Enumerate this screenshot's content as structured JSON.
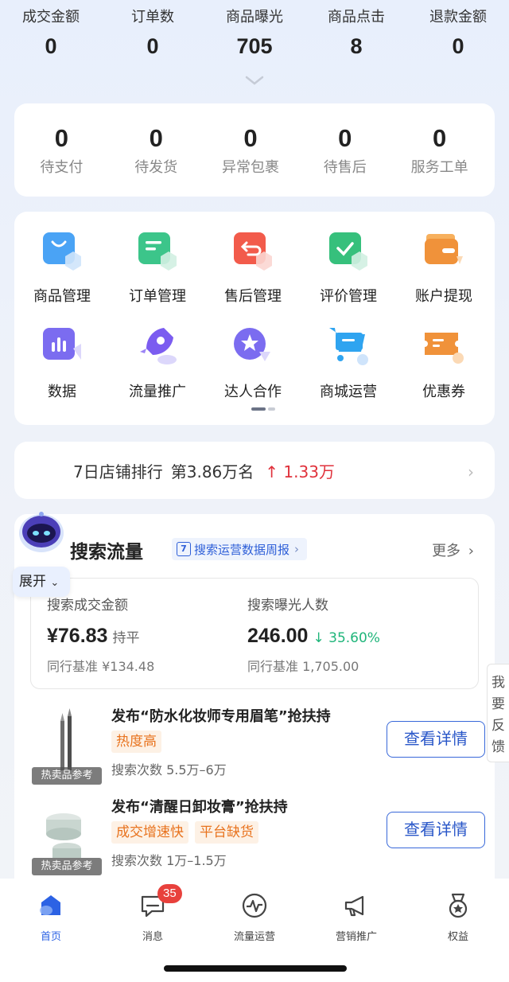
{
  "top_stats": [
    {
      "label": "成交金额",
      "value": "0"
    },
    {
      "label": "订单数",
      "value": "0"
    },
    {
      "label": "商品曝光",
      "value": "705"
    },
    {
      "label": "商品点击",
      "value": "8"
    },
    {
      "label": "退款金额",
      "value": "0"
    }
  ],
  "order_status": [
    {
      "label": "待支付",
      "value": "0"
    },
    {
      "label": "待发货",
      "value": "0"
    },
    {
      "label": "异常包裹",
      "value": "0"
    },
    {
      "label": "待售后",
      "value": "0"
    },
    {
      "label": "服务工单",
      "value": "0"
    }
  ],
  "tools": [
    {
      "label": "商品管理",
      "icon": "shopping-bag-icon"
    },
    {
      "label": "订单管理",
      "icon": "order-list-icon"
    },
    {
      "label": "售后管理",
      "icon": "return-icon"
    },
    {
      "label": "评价管理",
      "icon": "review-check-icon"
    },
    {
      "label": "账户提现",
      "icon": "wallet-icon"
    },
    {
      "label": "数据",
      "icon": "bar-chart-icon"
    },
    {
      "label": "流量推广",
      "icon": "rocket-icon"
    },
    {
      "label": "达人合作",
      "icon": "star-badge-icon"
    },
    {
      "label": "商城运营",
      "icon": "cart-icon"
    },
    {
      "label": "优惠券",
      "icon": "coupon-icon"
    }
  ],
  "rank": {
    "text": "7日店铺排行",
    "rank": "第3.86万名",
    "change": "1.33万"
  },
  "search": {
    "title": "搜索流量",
    "tag_day": "7",
    "tag": "搜索运营数据周报",
    "more": "更多",
    "metrics": [
      {
        "label": "搜索成交金额",
        "value": "¥76.83",
        "trend": "持平",
        "benchmark": "同行基准 ¥134.48"
      },
      {
        "label": "搜索曝光人数",
        "value": "246.00",
        "trend": "35.60%",
        "benchmark": "同行基准 1,705.00"
      }
    ],
    "products": [
      {
        "title": "发布“防水化妆师专用眉笔”抢扶持",
        "tags": [
          "热度高"
        ],
        "count": "搜索次数 5.5万–6万",
        "ref": "热卖品参考",
        "button": "查看详情"
      },
      {
        "title": "发布“清醒日卸妆膏”抢扶持",
        "tags": [
          "成交增速快",
          "平台缺货"
        ],
        "count": "搜索次数 1万–1.5万",
        "ref": "热卖品参考",
        "button": "查看详情"
      }
    ]
  },
  "floating": {
    "expand": "展开"
  },
  "feedback": "我要反馈",
  "tabs": [
    {
      "label": "首页",
      "icon": "home-icon",
      "active": true
    },
    {
      "label": "消息",
      "icon": "message-icon",
      "badge": "35"
    },
    {
      "label": "流量运营",
      "icon": "pulse-icon"
    },
    {
      "label": "营销推广",
      "icon": "megaphone-icon"
    },
    {
      "label": "权益",
      "icon": "medal-icon"
    }
  ],
  "colors": {
    "accent": "#2c62e4",
    "up": "#e0323c",
    "down": "#1fb57a",
    "tag": "#e8731e"
  }
}
